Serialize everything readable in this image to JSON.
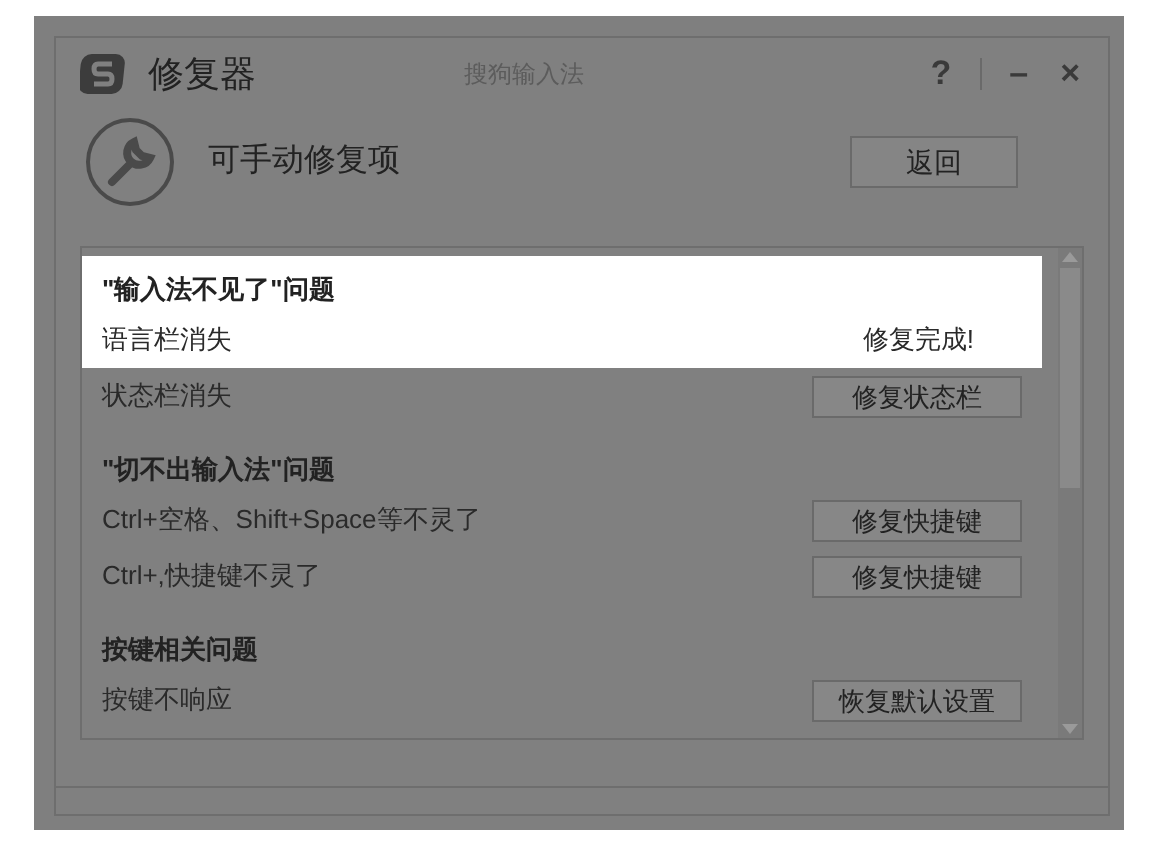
{
  "window": {
    "title": "修复器",
    "subtitle": "搜狗输入法",
    "controls": [
      "?",
      "–",
      "×"
    ]
  },
  "header": {
    "title": "可手动修复项",
    "back_button": "返回"
  },
  "rows": [
    {
      "kind": "heading",
      "label": "\"输入法不见了\"问题",
      "highlighted": true
    },
    {
      "kind": "item",
      "label": "语言栏消失",
      "action": {
        "kind": "status",
        "label": "修复完成!"
      },
      "highlighted": true
    },
    {
      "kind": "item",
      "label": "状态栏消失",
      "action": {
        "kind": "button",
        "label": "修复状态栏"
      },
      "highlighted": false
    },
    {
      "kind": "heading",
      "label": "\"切不出输入法\"问题",
      "highlighted": false
    },
    {
      "kind": "item",
      "label": "Ctrl+空格、Shift+Space等不灵了",
      "action": {
        "kind": "button",
        "label": "修复快捷键"
      },
      "highlighted": false
    },
    {
      "kind": "item",
      "label": "Ctrl+,快捷键不灵了",
      "action": {
        "kind": "button",
        "label": "修复快捷键"
      },
      "highlighted": false
    },
    {
      "kind": "heading",
      "label": "按键相关问题",
      "highlighted": false
    },
    {
      "kind": "item",
      "label": "按键不响应",
      "action": {
        "kind": "button",
        "label": "恢复默认设置"
      },
      "highlighted": false
    }
  ]
}
